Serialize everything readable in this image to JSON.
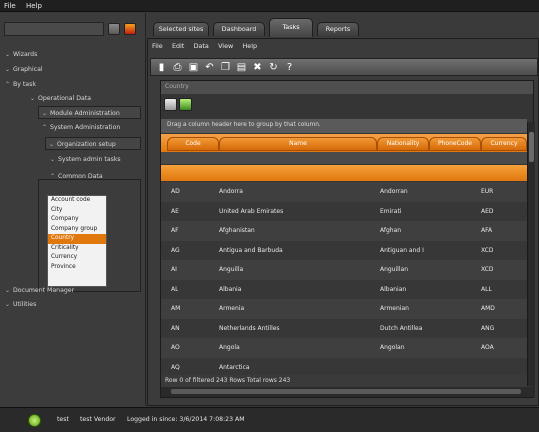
{
  "menubar": {
    "file": "File",
    "help": "Help"
  },
  "sidebar": {
    "search_value": "",
    "items": [
      {
        "label": "Wizards",
        "chev": "⌄"
      },
      {
        "label": "Graphical",
        "chev": "⌄"
      },
      {
        "label": "By task",
        "chev": "⌃"
      },
      {
        "label": "Operational Data",
        "chev": "⌄"
      },
      {
        "label": "Module Administration",
        "chev": "⌄"
      },
      {
        "label": "System Administration",
        "chev": "⌃"
      },
      {
        "label": "Organization setup",
        "chev": "⌄"
      },
      {
        "label": "System admin tasks",
        "chev": "⌄"
      },
      {
        "label": "Common Data",
        "chev": "⌃"
      },
      {
        "label": "Document Manager",
        "chev": "⌄"
      },
      {
        "label": "Utilities",
        "chev": "⌄"
      }
    ],
    "common_data_list": [
      "Account code",
      "City",
      "Company",
      "Company group",
      "Country",
      "Criticality",
      "Currency",
      "Province"
    ],
    "selected": "Country"
  },
  "tabs": [
    "Selected sites",
    "Dashboard",
    "Tasks",
    "Reports"
  ],
  "active_tab": "Tasks",
  "submenu": [
    "File",
    "Edit",
    "Data",
    "View",
    "Help"
  ],
  "window": {
    "title": "Country",
    "group_hint": "Drag a column header here to group by that column.",
    "columns": [
      "Code",
      "Name",
      "Nationality",
      "PhoneCode",
      "Currency"
    ],
    "rows": [
      {
        "code": "AD",
        "name": "Andorra",
        "nationality": "Andorran",
        "phone": "",
        "currency": "EUR"
      },
      {
        "code": "AE",
        "name": "United Arab Emirates",
        "nationality": "Emirati",
        "phone": "",
        "currency": "AED"
      },
      {
        "code": "AF",
        "name": "Afghanistan",
        "nationality": "Afghan",
        "phone": "",
        "currency": "AFA"
      },
      {
        "code": "AG",
        "name": "Antigua and Barbuda",
        "nationality": "Antiguan and I",
        "phone": "",
        "currency": "XCD"
      },
      {
        "code": "AI",
        "name": "Anguilla",
        "nationality": "Anguillan",
        "phone": "",
        "currency": "XCD"
      },
      {
        "code": "AL",
        "name": "Albania",
        "nationality": "Albanian",
        "phone": "",
        "currency": "ALL"
      },
      {
        "code": "AM",
        "name": "Armenia",
        "nationality": "Armenian",
        "phone": "",
        "currency": "AMD"
      },
      {
        "code": "AN",
        "name": "Netherlands Antilles",
        "nationality": "Dutch Antillea",
        "phone": "",
        "currency": "ANG"
      },
      {
        "code": "AO",
        "name": "Angola",
        "nationality": "Angolan",
        "phone": "",
        "currency": "AOA"
      },
      {
        "code": "AQ",
        "name": "Antarctica",
        "nationality": "",
        "phone": "",
        "currency": ""
      }
    ],
    "footer": "Row 0 of filtered 243 Rows   Total rows 243"
  },
  "status": {
    "user": "test",
    "vendor": "test Vendor",
    "logged_in": "Logged in since: 3/6/2014 7:08:23 AM"
  },
  "colors": {
    "accent": "#e0780e",
    "background": "#3a3a3a"
  }
}
